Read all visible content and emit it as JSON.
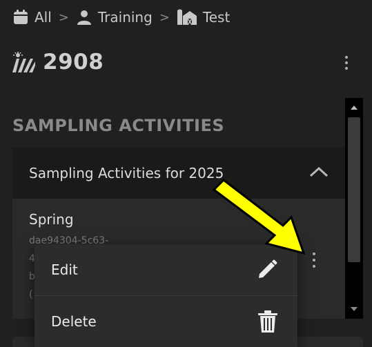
{
  "breadcrumb": {
    "items": [
      {
        "label": "All",
        "icon": "calendar-icon"
      },
      {
        "label": "Training",
        "icon": "person-icon"
      },
      {
        "label": "Test",
        "icon": "farm-building-icon"
      }
    ],
    "separator": ">"
  },
  "field": {
    "title": "2908",
    "icon": "field-rows-icon"
  },
  "section": {
    "title": "SAMPLING ACTIVITIES"
  },
  "accordion": {
    "title": "Sampling Activities for 2025",
    "items": [
      {
        "name": "Spring",
        "id_lines": [
          "dae94304-5c63-",
          "4",
          "b",
          "("
        ]
      }
    ]
  },
  "menu": {
    "items": [
      {
        "label": "Edit",
        "icon": "pencil-icon"
      },
      {
        "label": "Delete",
        "icon": "trash-icon"
      }
    ]
  },
  "colors": {
    "background": "#202020",
    "accordion_header": "#1a1a1a",
    "card": "#2a2a2a",
    "menu": "#2c2c2c",
    "annotation_arrow": "#ffff00"
  }
}
